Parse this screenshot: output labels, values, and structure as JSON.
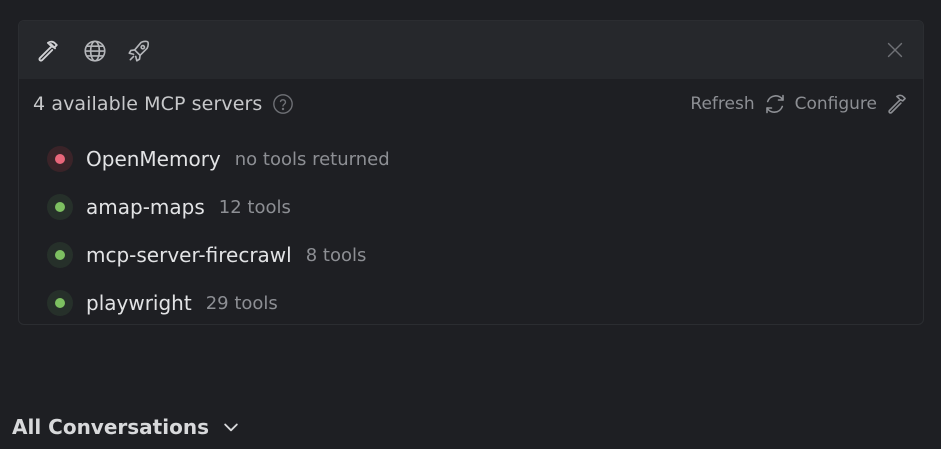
{
  "colors": {
    "background": "#1e1f23",
    "toolbar": "#26282c",
    "status_error": "#e8667a",
    "status_ok": "#7dc061",
    "muted_text": "#8d8f94"
  },
  "toolbar": {
    "icons": [
      "hammer-icon",
      "globe-icon",
      "rocket-icon"
    ],
    "close_icon": "close-icon"
  },
  "mcp": {
    "title": "4 available MCP servers",
    "help_icon": "question-icon",
    "refresh_label": "Refresh",
    "refresh_icon": "refresh-icon",
    "configure_label": "Configure",
    "configure_icon": "hammer-icon",
    "servers": [
      {
        "name": "OpenMemory",
        "meta": "no tools returned",
        "status": "error"
      },
      {
        "name": "amap-maps",
        "meta": "12 tools",
        "status": "ok"
      },
      {
        "name": "mcp-server-firecrawl",
        "meta": "8 tools",
        "status": "ok"
      },
      {
        "name": "playwright",
        "meta": "29 tools",
        "status": "ok"
      }
    ]
  },
  "conversations": {
    "label": "All Conversations",
    "icon": "chevron-down-icon"
  }
}
